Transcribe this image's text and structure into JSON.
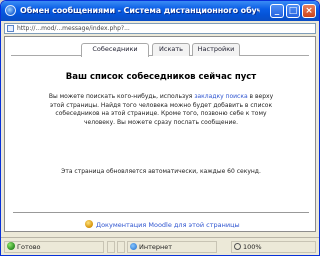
{
  "window": {
    "title": "Обмен сообщениями - Система дистанционного обучения - Windows...",
    "minimize": "_",
    "maximize": "□",
    "close": "×"
  },
  "address": {
    "url": "http://...mod/...message/index.php?..."
  },
  "tabs": [
    {
      "label": "Собеседники",
      "active": true
    },
    {
      "label": "Искать",
      "active": false
    },
    {
      "label": "Настройки",
      "active": false
    }
  ],
  "main": {
    "heading": "Ваш список собеседников сейчас пуст",
    "message_part1": "Вы можете поискать кого-нибудь, используя ",
    "message_link": "закладку поиска",
    "message_part2": " в верху этой страницы. Найдя того человека можно будет добавить в список собеседников на этой странице. Кроме того, позвоню себе к тому человеку. Вы можете сразу послать сообщение.",
    "autorefresh": "Эта страница обновляется автоматически, каждые 60 секунд.",
    "doc_link": "Документация Moodle для этой страницы"
  },
  "status": {
    "main": "Готово",
    "zone": "Интернет",
    "zoom": "100%"
  }
}
